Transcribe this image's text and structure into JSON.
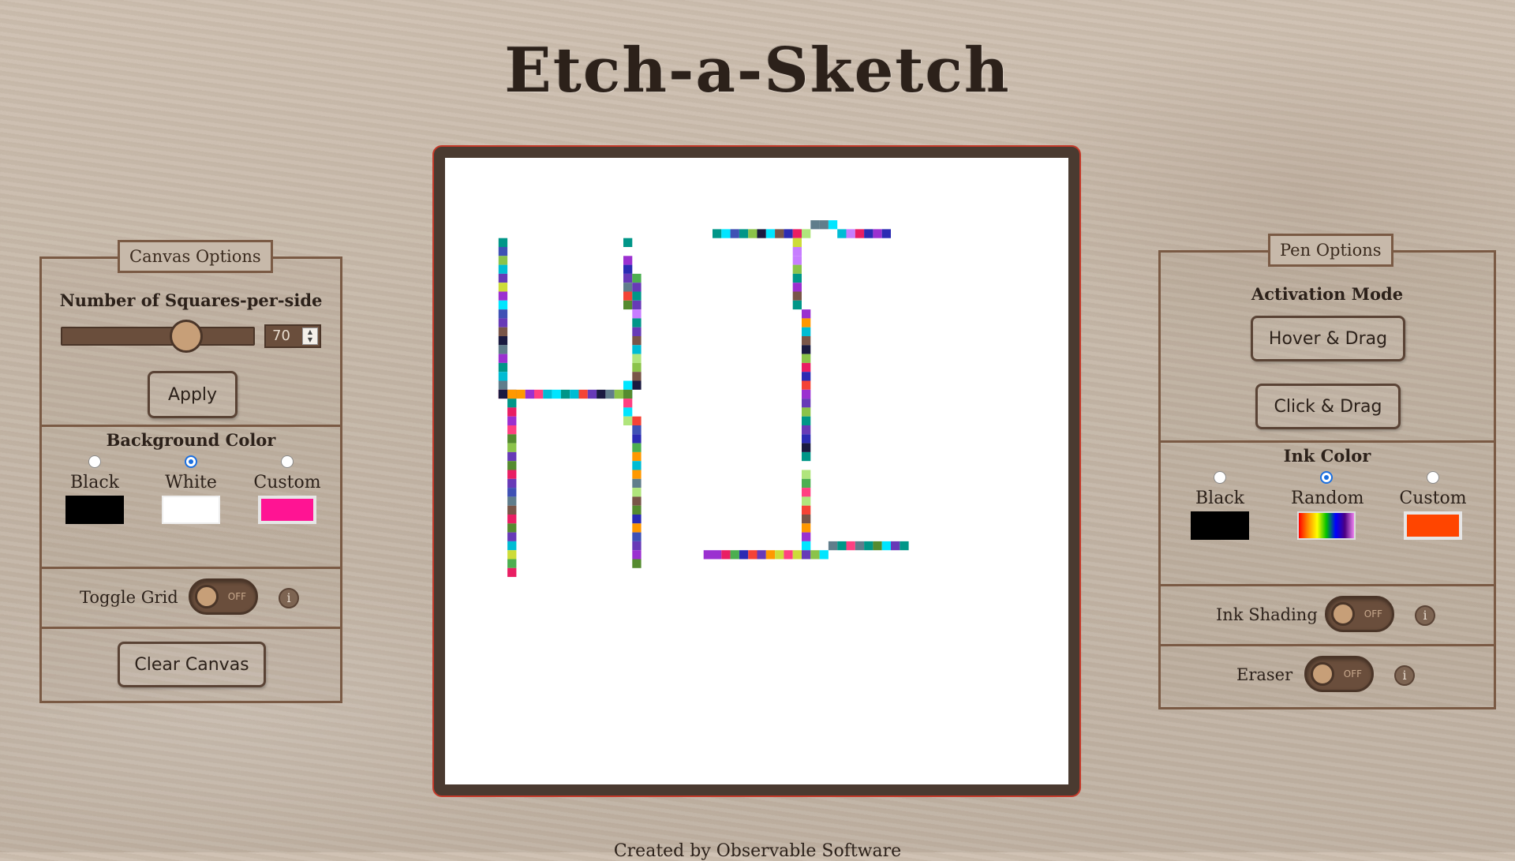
{
  "title": "Etch-a-Sketch",
  "canvas_options": {
    "legend": "Canvas Options",
    "squares_heading": "Number of Squares-per-side",
    "squares_value": "70",
    "slider_fraction": 0.65,
    "apply_label": "Apply",
    "bg_heading": "Background Color",
    "bg_options": [
      {
        "label": "Black",
        "color": "#000000",
        "checked": false
      },
      {
        "label": "White",
        "color": "#ffffff",
        "checked": true
      },
      {
        "label": "Custom",
        "color": "#ff1493",
        "checked": false
      }
    ],
    "grid_label": "Toggle Grid",
    "grid_state": "OFF",
    "info_glyph": "i",
    "clear_label": "Clear Canvas"
  },
  "pen_options": {
    "legend": "Pen Options",
    "mode_heading": "Activation Mode",
    "hover_label": "Hover & Drag",
    "click_label": "Click & Drag",
    "ink_heading": "Ink Color",
    "ink_options": [
      {
        "label": "Black",
        "color": "#000000",
        "checked": false
      },
      {
        "label": "Random",
        "color": "rainbow",
        "checked": true
      },
      {
        "label": "Custom",
        "color": "#ff4500",
        "checked": false
      }
    ],
    "shading_label": "Ink Shading",
    "shading_state": "OFF",
    "eraser_label": "Eraser",
    "eraser_state": "OFF",
    "info_glyph": "i"
  },
  "colors": {
    "wood_dark": "#4a3528",
    "panel_border": "#7a5a44",
    "frame_border": "#c43a2a"
  },
  "footer": "Created by Observable Software"
}
